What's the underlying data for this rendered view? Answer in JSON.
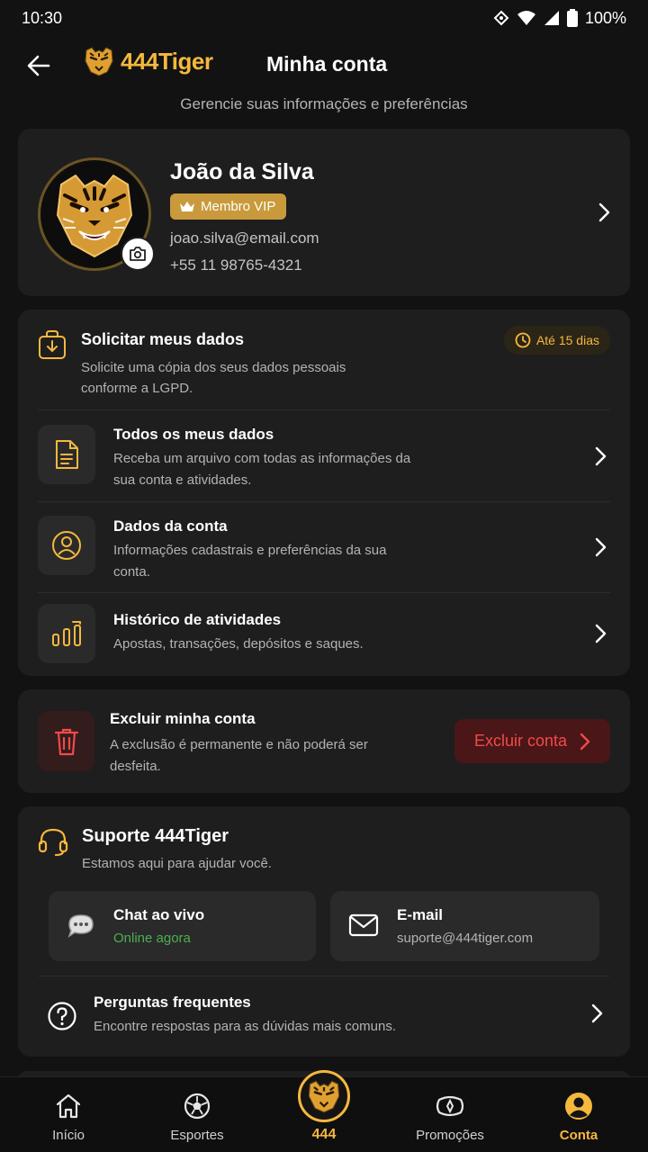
{
  "status_bar": {
    "time": "10:30",
    "battery": "100%"
  },
  "header": {
    "logo_text": "444Tiger",
    "title": "Minha conta",
    "subtitle": "Gerencie suas informações e preferências"
  },
  "profile": {
    "name": "João da Silva",
    "badge": "Membro VIP",
    "email": "joao.silva@email.com",
    "phone": "+55 11 98765-4321"
  },
  "data_request": {
    "title": "Solicitar meus dados",
    "description": "Solicite uma cópia dos seus dados pessoais conforme a LGPD.",
    "badge": "Até 15 dias",
    "items": [
      {
        "title": "Todos os meus dados",
        "description": "Receba um arquivo com todas as informações da sua conta e atividades.",
        "icon": "document-icon"
      },
      {
        "title": "Dados da conta",
        "description": "Informações cadastrais e preferências da sua conta.",
        "icon": "user-circle-icon"
      },
      {
        "title": "Histórico de atividades",
        "description": "Apostas, transações, depósitos e saques.",
        "icon": "bar-chart-icon"
      }
    ]
  },
  "delete_account": {
    "title": "Excluir minha conta",
    "description": "A exclusão é permanente e não poderá ser desfeita.",
    "button": "Excluir conta"
  },
  "support": {
    "title": "Suporte 444Tiger",
    "description": "Estamos aqui para ajudar você.",
    "chat": {
      "title": "Chat ao vivo",
      "status": "Online agora"
    },
    "email": {
      "title": "E-mail",
      "address": "suporte@444tiger.com"
    },
    "faq": {
      "title": "Perguntas frequentes",
      "description": "Encontre respostas para as dúvidas mais comuns."
    }
  },
  "bottom_nav": {
    "items": [
      {
        "label": "Início",
        "icon": "home-icon"
      },
      {
        "label": "Esportes",
        "icon": "soccer-ball-icon"
      },
      {
        "label": "444",
        "icon": "tiger-logo-icon"
      },
      {
        "label": "Promoções",
        "icon": "gift-icon"
      },
      {
        "label": "Conta",
        "icon": "account-icon"
      }
    ],
    "active": "Conta"
  },
  "colors": {
    "accent": "#f5b83d",
    "danger": "#f14a4a",
    "success": "#4caf50",
    "card": "#1e1e1e",
    "background": "#121212"
  }
}
